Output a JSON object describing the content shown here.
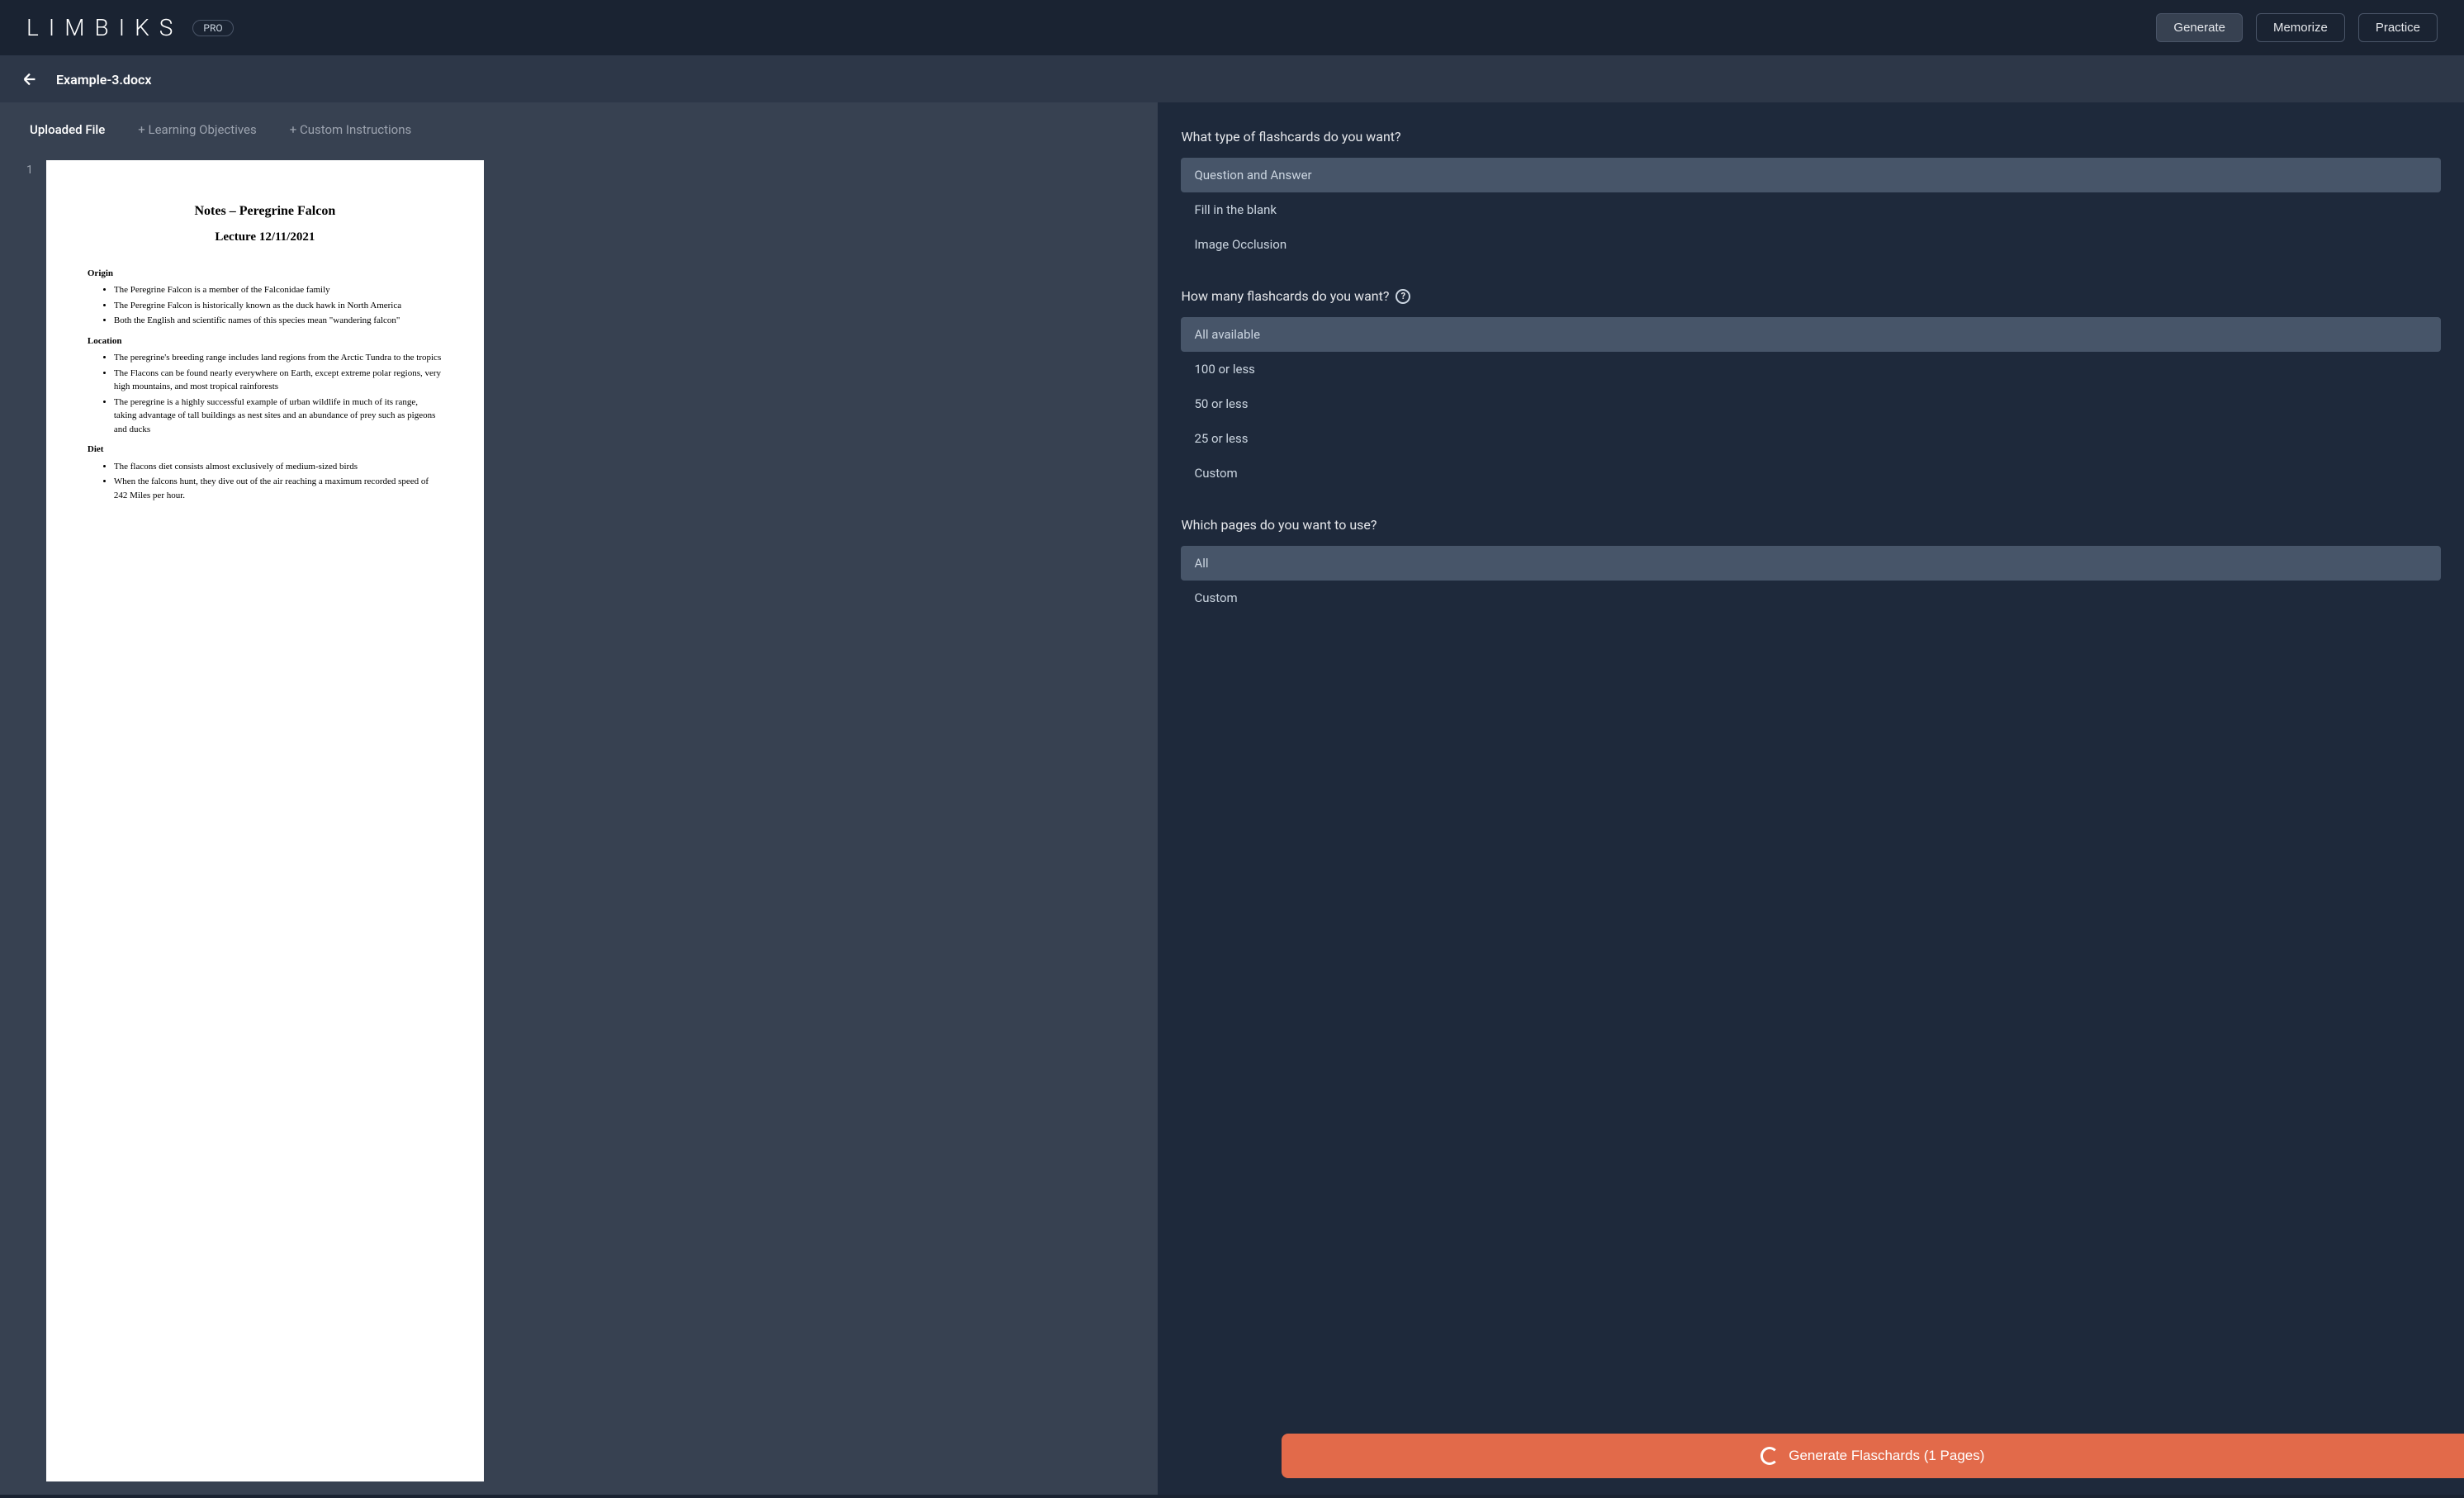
{
  "header": {
    "logo": "LIMBIKS",
    "badge": "PRO",
    "nav": {
      "generate": "Generate",
      "memorize": "Memorize",
      "practice": "Practice"
    }
  },
  "subheader": {
    "filename": "Example-3.docx"
  },
  "tabs": {
    "uploaded": "Uploaded File",
    "learning": "+ Learning Objectives",
    "custom": "+ Custom Instructions"
  },
  "doc": {
    "page_num": "1",
    "title": "Notes – Peregrine Falcon",
    "subtitle": "Lecture 12/11/2021",
    "sections": {
      "origin": {
        "heading": "Origin",
        "bullets": [
          "The Peregrine Falcon is a member of the Falconidae family",
          "The Peregrine Falcon is historically known as the duck hawk in North America",
          "Both the English and scientific names of this species mean \"wandering falcon\""
        ]
      },
      "location": {
        "heading": "Location",
        "bullets": [
          "The peregrine's breeding range includes land regions from the Arctic Tundra to the tropics",
          "The Flacons can be found nearly everywhere on Earth, except extreme polar regions, very high mountains, and most tropical rainforests",
          " The peregrine is a highly successful example of urban wildlife in much of its range, taking advantage of tall buildings as nest sites and an abundance of prey such as pigeons and ducks"
        ]
      },
      "diet": {
        "heading": "Diet",
        "bullets": [
          "The flacons diet consists almost exclusively of medium-sized birds",
          "When the falcons hunt, they dive out of the air reaching a maximum recorded speed of 242 Miles per hour."
        ]
      }
    }
  },
  "settings": {
    "type": {
      "label": "What type of flashcards do you want?",
      "options": {
        "qa": "Question and Answer",
        "fill": "Fill in the blank",
        "image": "Image Occlusion"
      }
    },
    "count": {
      "label": "How many flashcards do you want?",
      "options": {
        "all": "All available",
        "100": "100 or less",
        "50": "50 or less",
        "25": "25 or less",
        "custom": "Custom"
      }
    },
    "pages": {
      "label": "Which pages do you want to use?",
      "options": {
        "all": "All",
        "custom": "Custom"
      }
    }
  },
  "generate_button": "Generate Flaschards (1 Pages)"
}
